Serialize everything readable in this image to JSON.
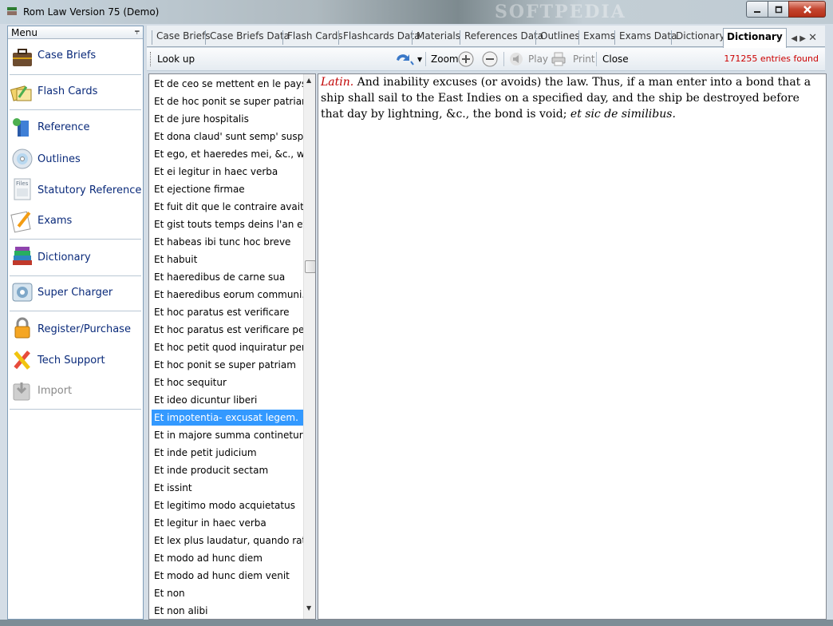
{
  "window": {
    "title": "Rom Law Version 75 (Demo)",
    "watermark": "SOFTPEDIA"
  },
  "menu": {
    "header": "Menu",
    "items": [
      {
        "label": "Case Briefs",
        "icon": "briefcase-icon"
      },
      {
        "label": "Flash Cards",
        "icon": "flash-cards-icon"
      },
      {
        "label": "Reference",
        "icon": "reference-icon"
      },
      {
        "label": "Outlines",
        "icon": "outlines-disc-icon"
      },
      {
        "label": "Statutory Reference",
        "icon": "files-icon"
      },
      {
        "label": "Exams",
        "icon": "exams-pencil-icon"
      },
      {
        "label": "Dictionary",
        "icon": "dictionary-books-icon"
      },
      {
        "label": "Super Charger",
        "icon": "super-charger-icon"
      },
      {
        "label": "Register/Purchase",
        "icon": "lock-icon"
      },
      {
        "label": "Tech Support",
        "icon": "tech-support-tools-icon"
      },
      {
        "label": "Import",
        "icon": "import-icon"
      }
    ]
  },
  "tabs": [
    "Case Briefs",
    "Case Briefs Data",
    "Flash Cards",
    "Flashcards Data",
    "Materials",
    "References Data",
    "Outlines",
    "Exams",
    "Exams Data",
    "Dictionary",
    "Dictionary"
  ],
  "toolbar": {
    "lookup": "Look up",
    "zoom": "Zoom",
    "play": "Play",
    "print": "Print",
    "close": "Close",
    "entries": "171255 entries found"
  },
  "list": {
    "selected_index": 19,
    "items": [
      "Et de ceo se mettent en le pays",
      "Et de hoc ponit se super patriam",
      "Et de jure hospitalis",
      "Et dona claud' sunt semp' susp...",
      "Et ego, et haeredes mei, &c., w...",
      "Et ei legitur in haec verba",
      "Et ejectione firmae",
      "Et fuit dit que le contraire avait e...",
      "Et gist touts temps deins l'an et...",
      "Et habeas ibi tunc hoc breve",
      "Et habuit",
      "Et haeredibus de carne sua",
      "Et haeredibus eorum communi...",
      "Et hoc paratus est verificare",
      "Et hoc paratus est verificare per...",
      "Et hoc petit quod inquiratur per ...",
      "Et hoc ponit se super patriam",
      "Et hoc sequitur",
      "Et ideo dicuntur liberi",
      "Et impotentia- excusat legem.",
      "Et in majore summa continetur ...",
      "Et inde petit judicium",
      "Et inde producit sectam",
      "Et issint",
      "Et legitimo modo acquietatus",
      "Et legitur in haec verba",
      "Et lex plus laudatur, quando rati...",
      "Et modo ad hunc diem",
      "Et modo ad hunc diem venit",
      "Et non",
      "Et non alibi"
    ]
  },
  "definition": {
    "lang": "Latin.",
    "body": " And inability excuses (or avoids) the law. Thus, if a man enter into a bond that a ship shall sail to the East Indies on a specified day, and the ship be destroyed before that day by lightning, &c., the bond is void; ",
    "tail": "et sic de similibus."
  }
}
